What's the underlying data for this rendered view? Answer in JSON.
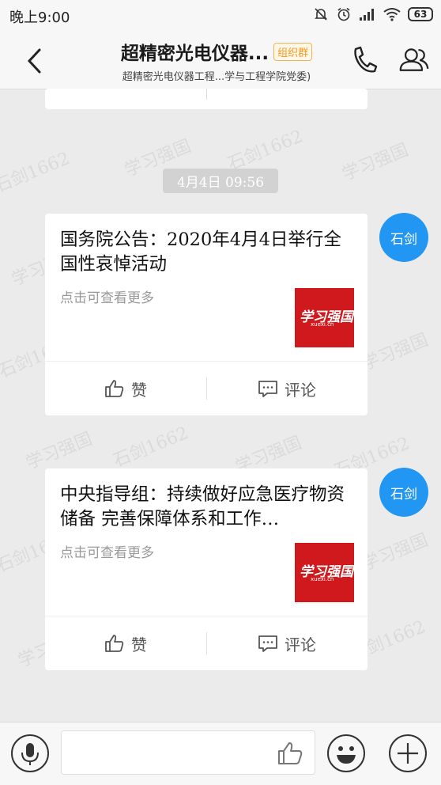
{
  "status_bar": {
    "time": "晚上9:00",
    "battery": "63"
  },
  "header": {
    "title": "超精密光电仪器...",
    "tag": "组织群",
    "subtitle": "超精密光电仪器工程...学与工程学院党委)"
  },
  "watermark": {
    "lines": [
      "石剑1662",
      "学习强国"
    ]
  },
  "timestamp": "4月4日 09:56",
  "messages": [
    {
      "sender_avatar": "石剑",
      "title": "国务院公告：2020年4月4日举行全国性哀悼活动",
      "desc": "点击可查看更多",
      "thumb_brand": "学习强国",
      "thumb_url": "xuexi.cn",
      "like_label": "赞",
      "comment_label": "评论"
    },
    {
      "sender_avatar": "石剑",
      "title": "中央指导组：持续做好应急医疗物资储备 完善保障体系和工作…",
      "desc": "点击可查看更多",
      "thumb_brand": "学习强国",
      "thumb_url": "xuexi.cn",
      "like_label": "赞",
      "comment_label": "评论"
    }
  ],
  "colors": {
    "accent_blue": "#2196f3",
    "thumb_red": "#d0191c",
    "tag_orange": "#f39a1c"
  },
  "icons": {
    "back": "chevron-left-icon",
    "phone": "phone-icon",
    "members": "people-icon",
    "voice": "microphone-icon",
    "emoji": "smile-icon",
    "add": "plus-icon",
    "like": "thumb-up-icon",
    "comment": "comment-icon"
  }
}
